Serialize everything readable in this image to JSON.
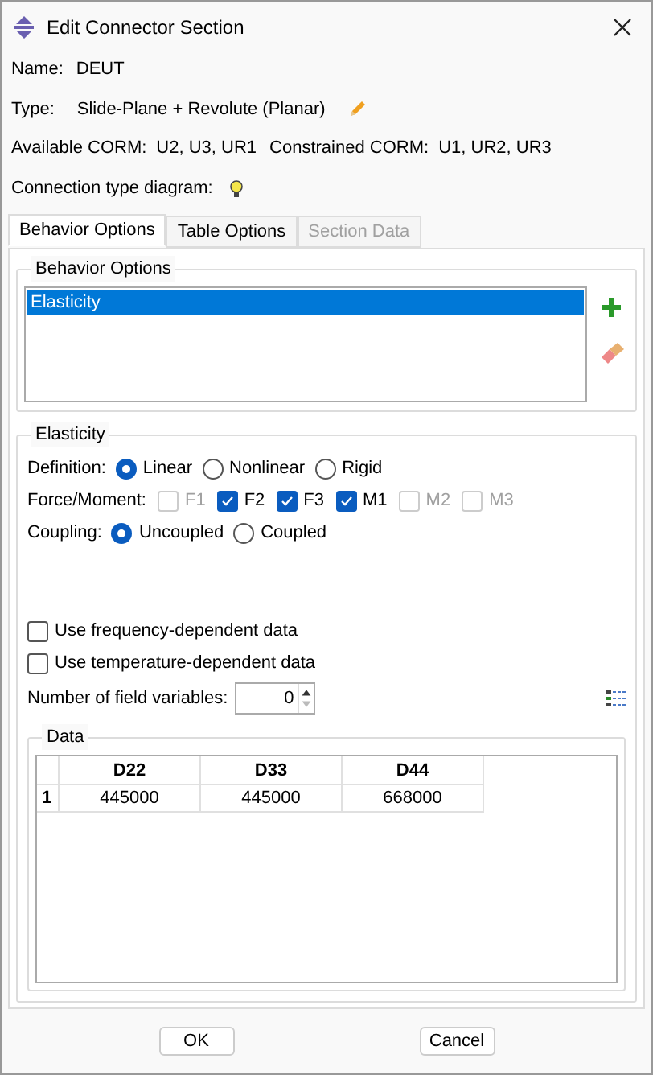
{
  "window": {
    "title": "Edit Connector Section"
  },
  "name": {
    "label": "Name:",
    "value": "DEUT"
  },
  "type": {
    "label": "Type:",
    "value": "Slide-Plane + Revolute (Planar)"
  },
  "corm": {
    "available_label": "Available CORM:",
    "available": "U2, U3, UR1",
    "constrained_label": "Constrained CORM:",
    "constrained": "U1, UR2, UR3"
  },
  "diagram": {
    "label": "Connection type diagram:"
  },
  "tabs": [
    {
      "label": "Behavior Options",
      "selected": true,
      "disabled": false
    },
    {
      "label": "Table Options",
      "selected": false,
      "disabled": false
    },
    {
      "label": "Section Data",
      "selected": false,
      "disabled": true
    }
  ],
  "behavior_options": {
    "title": "Behavior Options",
    "items": [
      {
        "label": "Elasticity",
        "selected": true
      }
    ]
  },
  "elasticity": {
    "title": "Elasticity",
    "definition": {
      "label": "Definition:",
      "options": [
        {
          "label": "Linear",
          "selected": true
        },
        {
          "label": "Nonlinear",
          "selected": false
        },
        {
          "label": "Rigid",
          "selected": false
        }
      ]
    },
    "force_moment": {
      "label": "Force/Moment:",
      "options": [
        {
          "label": "F1",
          "checked": false,
          "disabled": true
        },
        {
          "label": "F2",
          "checked": true,
          "disabled": false
        },
        {
          "label": "F3",
          "checked": true,
          "disabled": false
        },
        {
          "label": "M1",
          "checked": true,
          "disabled": false
        },
        {
          "label": "M2",
          "checked": false,
          "disabled": true
        },
        {
          "label": "M3",
          "checked": false,
          "disabled": true
        }
      ]
    },
    "coupling": {
      "label": "Coupling:",
      "options": [
        {
          "label": "Uncoupled",
          "selected": true
        },
        {
          "label": "Coupled",
          "selected": false
        }
      ]
    },
    "options": [
      {
        "label": "Use frequency-dependent data",
        "checked": false
      },
      {
        "label": "Use temperature-dependent data",
        "checked": false
      }
    ],
    "field_variables": {
      "label": "Number of field variables:",
      "value": "0"
    },
    "data": {
      "title": "Data",
      "columns": [
        "D22",
        "D33",
        "D44"
      ],
      "rows": [
        {
          "index": "1",
          "cells": [
            "445000",
            "445000",
            "668000"
          ]
        }
      ]
    }
  },
  "buttons": [
    "OK",
    "Cancel"
  ]
}
